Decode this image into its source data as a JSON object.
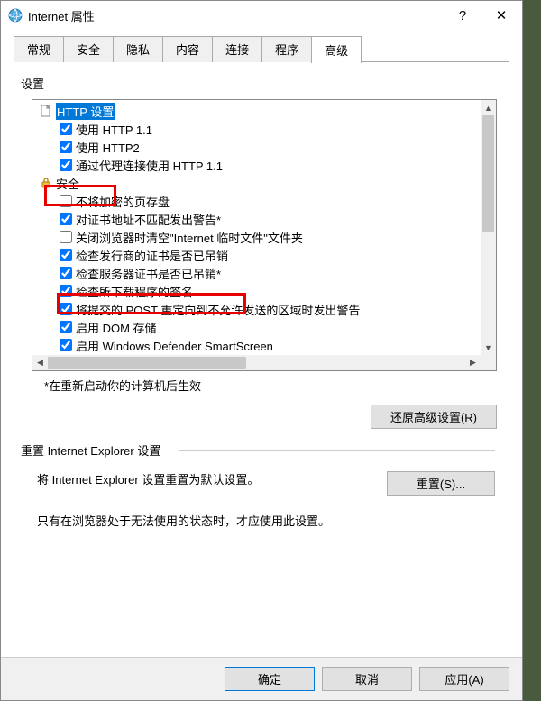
{
  "window": {
    "title": "Internet 属性",
    "help": "?",
    "close": "✕"
  },
  "tabs": [
    "常规",
    "安全",
    "隐私",
    "内容",
    "连接",
    "程序",
    "高级"
  ],
  "active_tab_index": 6,
  "group_label": "设置",
  "tree": [
    {
      "type": "header",
      "icon": "doc",
      "label": "HTTP 设置",
      "highlighted": true,
      "indent": 0
    },
    {
      "type": "check",
      "checked": true,
      "label": "使用 HTTP 1.1",
      "indent": 1
    },
    {
      "type": "check",
      "checked": true,
      "label": "使用 HTTP2",
      "indent": 1
    },
    {
      "type": "check",
      "checked": true,
      "label": "通过代理连接使用 HTTP 1.1",
      "indent": 1
    },
    {
      "type": "header",
      "icon": "lock",
      "label": "安全",
      "indent": 0
    },
    {
      "type": "check",
      "checked": false,
      "label": "不将加密的页存盘",
      "indent": 1
    },
    {
      "type": "check",
      "checked": true,
      "label": "对证书地址不匹配发出警告*",
      "indent": 1
    },
    {
      "type": "check",
      "checked": false,
      "label": "关闭浏览器时清空\"Internet 临时文件\"文件夹",
      "indent": 1
    },
    {
      "type": "check",
      "checked": true,
      "label": "检查发行商的证书是否已吊销",
      "indent": 1
    },
    {
      "type": "check",
      "checked": true,
      "label": "检查服务器证书是否已吊销*",
      "indent": 1
    },
    {
      "type": "check",
      "checked": true,
      "label": "检查所下载程序的签名",
      "indent": 1
    },
    {
      "type": "check",
      "checked": true,
      "label": "将提交的 POST 重定向到不允许发送的区域时发出警告",
      "indent": 1
    },
    {
      "type": "check",
      "checked": true,
      "label": "启用 DOM 存储",
      "indent": 1
    },
    {
      "type": "check",
      "checked": true,
      "label": "启用 Windows Defender SmartScreen",
      "indent": 1
    }
  ],
  "note": "*在重新启动你的计算机后生效",
  "restore_button": "还原高级设置(R)",
  "reset": {
    "title": "重置 Internet Explorer 设置",
    "text": "将 Internet Explorer 设置重置为默认设置。",
    "button": "重置(S)...",
    "warn": "只有在浏览器处于无法使用的状态时，才应使用此设置。"
  },
  "buttons": {
    "ok": "确定",
    "cancel": "取消",
    "apply": "应用(A)"
  }
}
